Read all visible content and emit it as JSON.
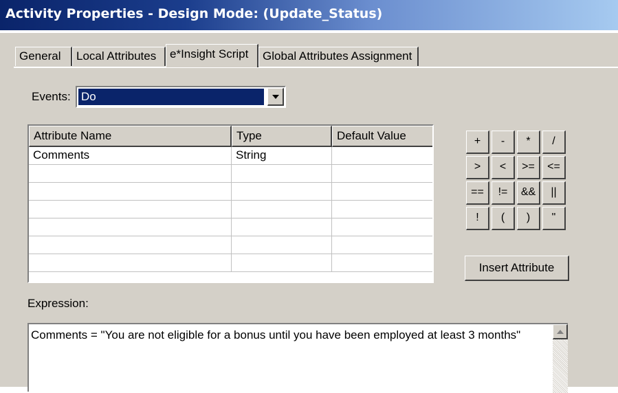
{
  "window": {
    "title": "Activity Properties - Design Mode: (Update_Status)"
  },
  "tabs": [
    {
      "label": "General"
    },
    {
      "label": "Local Attributes"
    },
    {
      "label": "e*Insight Script",
      "active": true
    },
    {
      "label": "Global Attributes Assignment"
    }
  ],
  "events": {
    "label": "Events:",
    "selected": "Do"
  },
  "attributes_table": {
    "columns": [
      "Attribute Name",
      "Type",
      "Default Value"
    ],
    "rows": [
      [
        "Comments",
        "String",
        ""
      ],
      [
        "",
        "",
        ""
      ],
      [
        "",
        "",
        ""
      ],
      [
        "",
        "",
        ""
      ],
      [
        "",
        "",
        ""
      ],
      [
        "",
        "",
        ""
      ],
      [
        "",
        "",
        ""
      ]
    ]
  },
  "operators": [
    [
      "+",
      "-",
      "*",
      "/"
    ],
    [
      ">",
      "<",
      ">=",
      "<="
    ],
    [
      "==",
      "!=",
      "&&",
      "||"
    ],
    [
      "!",
      "(",
      ")",
      "\""
    ]
  ],
  "insert_attribute_label": "Insert Attribute",
  "expression": {
    "label": "Expression:",
    "text": "Comments = \"You are not eligible for a bonus until you have been employed at least 3 months\""
  },
  "colors": {
    "title_bar": "#0a246a",
    "selection": "#0a246a",
    "face": "#d4d0c8"
  }
}
